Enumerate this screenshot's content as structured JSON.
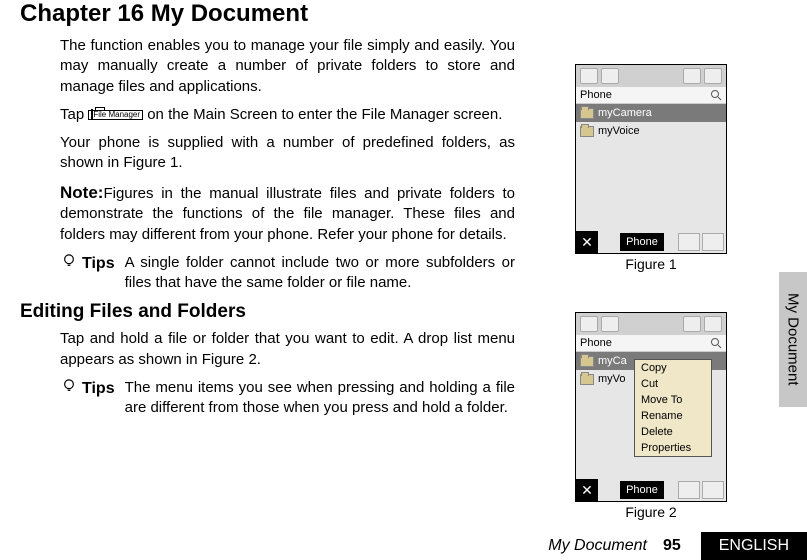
{
  "chapter_title": "Chapter 16 My Document",
  "para1": "The function enables you to manage your file simply and easily. You may manually create a number of private folders to store and manage files and applications.",
  "para2_a": "Tap ",
  "para2_icon_label": "File Manager",
  "para2_b": " on the Main Screen to enter the File Manager screen.",
  "para3": "Your phone is supplied with a number of predefined folders, as shown in Figure 1.",
  "note_label": "Note:",
  "note_text": "Figures in the manual illustrate files and private folders to demonstrate the functions of the file manager. These files and folders may different from your phone. Refer your phone for details.",
  "tips_label": "Tips",
  "tips1": "A single folder cannot include two or more subfolders or files that have the same folder or file name.",
  "section2_title": "Editing Files and Folders",
  "section2_para": "Tap and hold a file or folder that you want to edit. A drop list menu appears as shown in Figure 2.",
  "tips2": "The menu items you see when pressing and holding a file are different from those when you press and hold a folder.",
  "fig1": {
    "caption": "Figure 1",
    "header": "Phone",
    "items": [
      "myCamera",
      "myVoice"
    ],
    "bottom": "Phone"
  },
  "fig2": {
    "caption": "Figure 2",
    "header": "Phone",
    "items_prefix": [
      "myCa",
      "myVo"
    ],
    "menu": [
      "Copy",
      "Cut",
      "Move To",
      "Rename",
      "Delete",
      "Properties"
    ],
    "bottom": "Phone"
  },
  "side_tab": "My Document",
  "footer": {
    "doc": "My Document",
    "page": "95",
    "lang": "ENGLISH"
  }
}
